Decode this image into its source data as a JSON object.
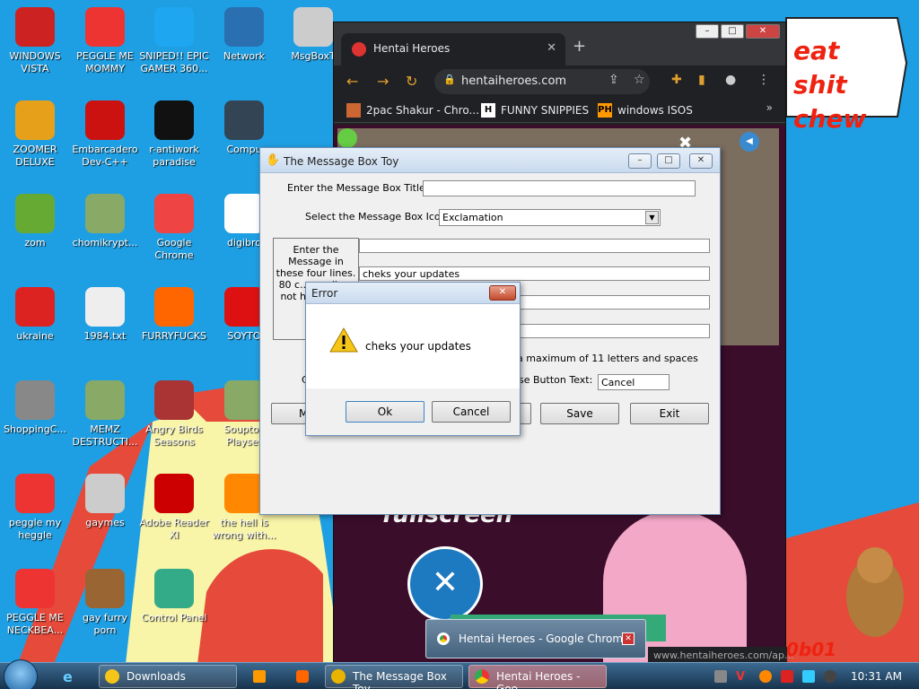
{
  "desktop_icons": [
    {
      "id": "windows-vista",
      "label": "WINDOWS VISTA",
      "icon": "orb-icon",
      "color": "#c22"
    },
    {
      "id": "peggle-me-mommy",
      "label": "PEGGLE ME MOMMY",
      "icon": "peggle-icon",
      "color": "#e33"
    },
    {
      "id": "sniped",
      "label": "SNIPED!! EPIC GAMER 360...",
      "icon": "skype-icon",
      "color": "#1ea7f0"
    },
    {
      "id": "network",
      "label": "Network",
      "icon": "network-globe-icon",
      "color": "#2a6fb0"
    },
    {
      "id": "msgboxt",
      "label": "MsgBoxT",
      "icon": "files-icon",
      "color": "#ccc"
    },
    {
      "id": "zoomer-deluxe",
      "label": "ZOOMER DELUXE",
      "icon": "zoomer-icon",
      "color": "#e7a01a"
    },
    {
      "id": "embarcadero",
      "label": "Embarcadero Dev-C++",
      "icon": "devcpp-icon",
      "color": "#c11"
    },
    {
      "id": "r-antiwork",
      "label": "r-antiwork paradise",
      "icon": "antiwork-icon",
      "color": "#111"
    },
    {
      "id": "computer",
      "label": "Compu",
      "icon": "computer-icon",
      "color": "#345"
    },
    {
      "id": "zom",
      "label": "zom",
      "icon": "flower-icon",
      "color": "#6a3"
    },
    {
      "id": "chomikrypt",
      "label": "chomikrypt...",
      "icon": "shortcut-icon",
      "color": "#8a6"
    },
    {
      "id": "google-chrome",
      "label": "Google Chrome",
      "icon": "chrome-icon",
      "color": "#e44"
    },
    {
      "id": "digibro",
      "label": "digibro",
      "icon": "file-icon",
      "color": "#fff"
    },
    {
      "id": "ukraine",
      "label": "ukraine",
      "icon": "radiation-icon",
      "color": "#d22"
    },
    {
      "id": "1984-txt",
      "label": "1984.txt",
      "icon": "text-file-icon",
      "color": "#eee"
    },
    {
      "id": "furryfucks",
      "label": "FURRYFUCKS",
      "icon": "firefox-icon",
      "color": "#f60"
    },
    {
      "id": "soyto",
      "label": "SOYTO",
      "icon": "soy-icon",
      "color": "#d11"
    },
    {
      "id": "shoppingc",
      "label": "ShoppingC...",
      "icon": "flash-icon",
      "color": "#888"
    },
    {
      "id": "memz",
      "label": "MEMZ DESTRUCTI...",
      "icon": "shortcut-icon",
      "color": "#8a6"
    },
    {
      "id": "angry-birds",
      "label": "Angry Birds Seasons",
      "icon": "angry-birds-icon",
      "color": "#a33"
    },
    {
      "id": "souptoy",
      "label": "Souptoy Playset",
      "icon": "shortcut-icon",
      "color": "#8a6"
    },
    {
      "id": "peggle-my-heggle",
      "label": "peggle my heggle",
      "icon": "peggle-icon",
      "color": "#e33"
    },
    {
      "id": "gaymes",
      "label": "gaymes",
      "icon": "folder-icon",
      "color": "#ccc"
    },
    {
      "id": "adobe-reader",
      "label": "Adobe Reader XI",
      "icon": "adobe-icon",
      "color": "#c00"
    },
    {
      "id": "the-hell",
      "label": "the hell is wrong with...",
      "icon": "uc-browser-icon",
      "color": "#f80"
    },
    {
      "id": "peggle-neckbea",
      "label": "PEGGLE ME NECKBEA...",
      "icon": "peggle-icon",
      "color": "#e33"
    },
    {
      "id": "gay-furry-porn",
      "label": "gay furry porn",
      "icon": "box-icon",
      "color": "#963"
    },
    {
      "id": "control-panel",
      "label": "Control Panel",
      "icon": "control-panel-icon",
      "color": "#3a8"
    }
  ],
  "desktop_scrawl": "eat shit chew",
  "chrome": {
    "tab_title": "Hentai Heroes",
    "url": "hentaiheroes.com",
    "bookmarks": [
      "2pac Shakur - Chro...",
      "FUNNY SNIPPIES",
      "windows ISOS"
    ],
    "bookmark_icons": [
      "H",
      "PH"
    ],
    "page_text": "fullscreen",
    "status_url": "www.hentaiheroes.com/ap...",
    "tooltip": "Hentai Heroes - Google Chrome"
  },
  "msgbox_toy": {
    "title": "The Message Box Toy",
    "title_label": "Enter the Message Box Title:",
    "title_value": "",
    "icon_label": "Select the Message Box Icon:",
    "icon_value": "Exclamation",
    "message_label": "Enter the Message in these four lines. 80 c... per lin... not ha... all f...",
    "lines": [
      "",
      "cheks your updates",
      "",
      ""
    ],
    "max_note": "a maximum of 11 letters and spaces",
    "button_text_label": "se Button Text:",
    "button_text_value": "Cancel",
    "left_label_fragment": "C",
    "btn_left": "M",
    "save": "Save",
    "exit": "Exit"
  },
  "error_dialog": {
    "title": "Error",
    "message": "cheks your updates",
    "ok": "Ok",
    "cancel": "Cancel"
  },
  "taskbar": {
    "items": [
      "Downloads",
      "The Message Box Toy",
      "Hentai Heroes - Goo..."
    ],
    "clock": "10:31 AM"
  },
  "watermark": "0b01"
}
